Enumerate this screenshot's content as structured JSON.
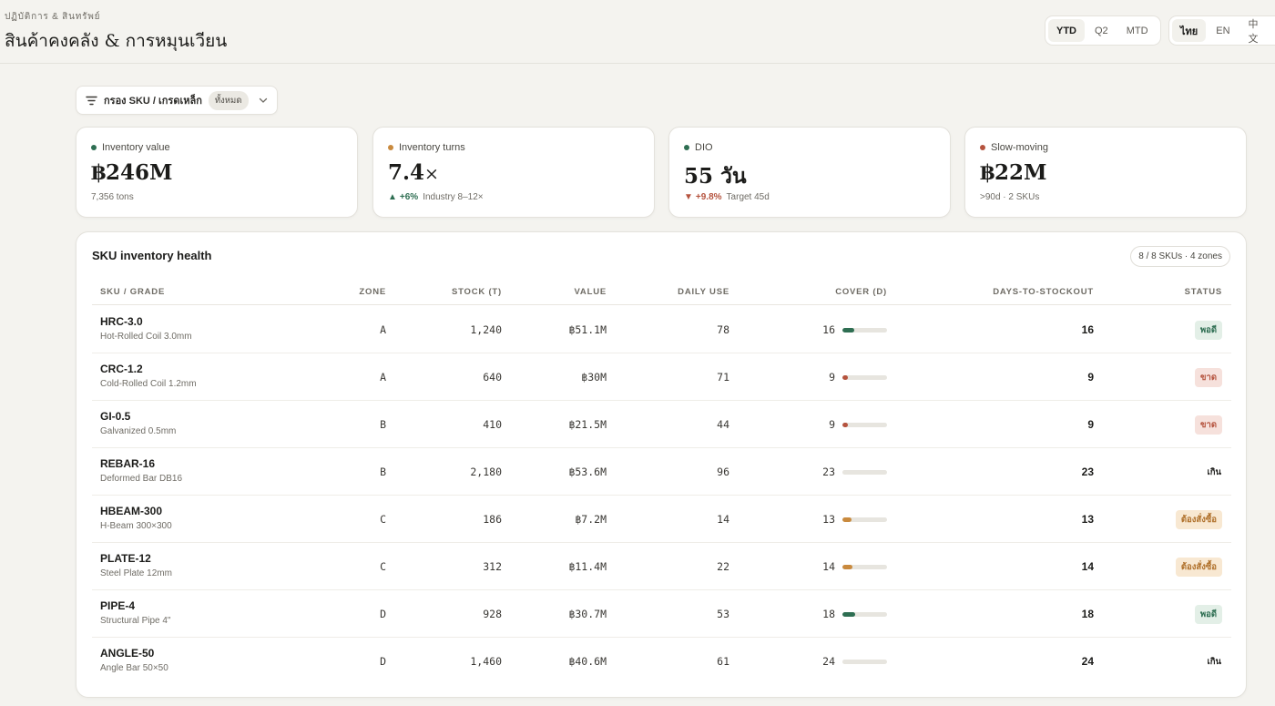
{
  "header": {
    "eyebrow": "ปฏิบัติการ & สินทรัพย์",
    "title": "สินค้าคงคลัง & การหมุนเวียน"
  },
  "period_tabs": [
    {
      "label": "YTD",
      "active": true
    },
    {
      "label": "Q2",
      "active": false
    },
    {
      "label": "MTD",
      "active": false
    }
  ],
  "language_tabs": [
    {
      "label": "ไทย",
      "active": true
    },
    {
      "label": "EN",
      "active": false
    },
    {
      "label": "中文",
      "active": false
    }
  ],
  "filter": {
    "label": "กรอง SKU / เกรดเหล็ก",
    "chip": "ทั้งหมด",
    "icon": "filter-icon",
    "chevron_icon": "chevron-down-icon"
  },
  "kpis": [
    {
      "label": "Inventory value",
      "dot_color": "#2e6e52",
      "value": "฿246M",
      "unit": "",
      "delta": "",
      "delta_dir": "",
      "sub": "7,356 tons"
    },
    {
      "label": "Inventory turns",
      "dot_color": "#c98a3e",
      "value": "7.4",
      "unit": "×",
      "delta": "+6%",
      "delta_dir": "up",
      "sub": "Industry 8–12×"
    },
    {
      "label": "DIO",
      "dot_color": "#2e6e52",
      "value": "55 วัน",
      "unit": "",
      "delta": "+9.8%",
      "delta_dir": "down",
      "sub": "Target 45d"
    },
    {
      "label": "Slow-moving",
      "dot_color": "#b5533e",
      "value": "฿22M",
      "unit": "",
      "delta": "",
      "delta_dir": "",
      "sub": ">90d · 2 SKUs"
    }
  ],
  "table": {
    "title": "SKU inventory health",
    "badge": "8 / 8 SKUs · 4 zones",
    "columns": {
      "sku": "SKU / GRADE",
      "zone": "ZONE",
      "stock": "STOCK (T)",
      "value": "VALUE",
      "daily_use": "DAILY USE",
      "cover": "COVER (D)",
      "dts": "DAYS-TO-STOCKOUT",
      "status": "STATUS"
    },
    "status_styles": {
      "พอดี": {
        "bg": "#e3efe7",
        "fg": "#2e6e52"
      },
      "ขาด": {
        "bg": "#f6e1dc",
        "fg": "#b5533e"
      },
      "เกิน": {
        "bg": "transparent",
        "fg": "#1c1c1a"
      },
      "ต้องสั่งซื้อ": {
        "bg": "#f8e8d2",
        "fg": "#b0712c"
      }
    },
    "cover_colors": {
      "พอดี": "#2e6e52",
      "ขาด": "#b5533e",
      "เกิน": "#e7e5df",
      "ต้องสั่งซื้อ": "#c98a3e"
    },
    "rows": [
      {
        "code": "HRC-3.0",
        "name": "Hot-Rolled Coil 3.0mm",
        "zone": "A",
        "stock": "1,240",
        "value": "฿51.1M",
        "daily_use": "78",
        "cover": "16",
        "cover_level": 0.27,
        "dts": "16",
        "status": "พอดี"
      },
      {
        "code": "CRC-1.2",
        "name": "Cold-Rolled Coil 1.2mm",
        "zone": "A",
        "stock": "640",
        "value": "฿30M",
        "daily_use": "71",
        "cover": "9",
        "cover_level": 0.12,
        "dts": "9",
        "status": "ขาด"
      },
      {
        "code": "GI-0.5",
        "name": "Galvanized 0.5mm",
        "zone": "B",
        "stock": "410",
        "value": "฿21.5M",
        "daily_use": "44",
        "cover": "9",
        "cover_level": 0.12,
        "dts": "9",
        "status": "ขาด"
      },
      {
        "code": "REBAR-16",
        "name": "Deformed Bar DB16",
        "zone": "B",
        "stock": "2,180",
        "value": "฿53.6M",
        "daily_use": "96",
        "cover": "23",
        "cover_level": 0.4,
        "dts": "23",
        "status": "เกิน"
      },
      {
        "code": "HBEAM-300",
        "name": "H-Beam 300×300",
        "zone": "C",
        "stock": "186",
        "value": "฿7.2M",
        "daily_use": "14",
        "cover": "13",
        "cover_level": 0.2,
        "dts": "13",
        "status": "ต้องสั่งซื้อ"
      },
      {
        "code": "PLATE-12",
        "name": "Steel Plate 12mm",
        "zone": "C",
        "stock": "312",
        "value": "฿11.4M",
        "daily_use": "22",
        "cover": "14",
        "cover_level": 0.22,
        "dts": "14",
        "status": "ต้องสั่งซื้อ"
      },
      {
        "code": "PIPE-4",
        "name": "Structural Pipe 4\"",
        "zone": "D",
        "stock": "928",
        "value": "฿30.7M",
        "daily_use": "53",
        "cover": "18",
        "cover_level": 0.28,
        "dts": "18",
        "status": "พอดี"
      },
      {
        "code": "ANGLE-50",
        "name": "Angle Bar 50×50",
        "zone": "D",
        "stock": "1,460",
        "value": "฿40.6M",
        "daily_use": "61",
        "cover": "24",
        "cover_level": 0.4,
        "dts": "24",
        "status": "เกิน"
      }
    ]
  }
}
